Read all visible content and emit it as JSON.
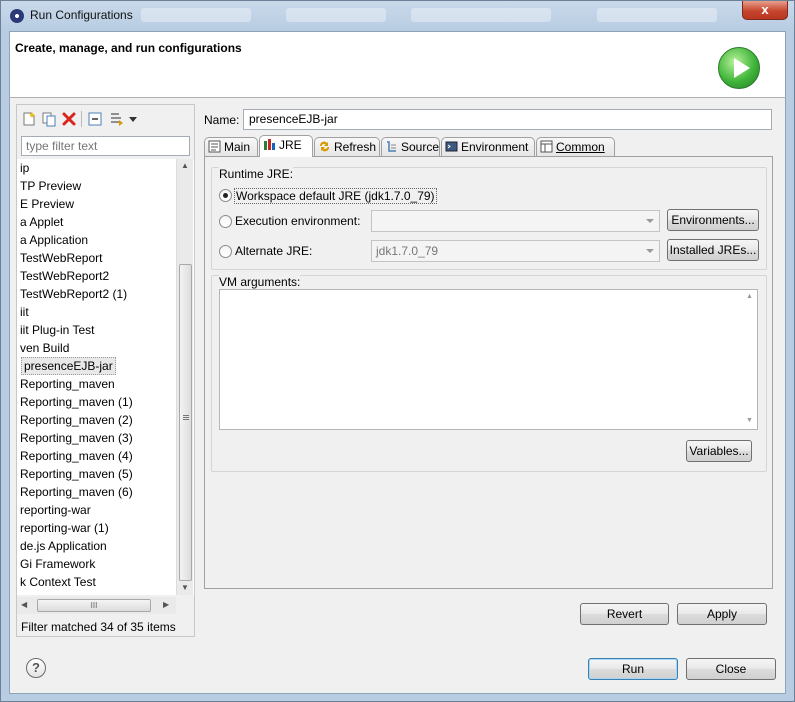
{
  "window": {
    "title": "Run Configurations",
    "close_label": "x"
  },
  "header": {
    "title": "Create, manage, and run configurations"
  },
  "left": {
    "filter_placeholder": "type filter text",
    "items": [
      {
        "label": "ip"
      },
      {
        "label": "TP Preview"
      },
      {
        "label": "E Preview"
      },
      {
        "label": "a Applet"
      },
      {
        "label": "a Application"
      },
      {
        "label": "TestWebReport"
      },
      {
        "label": "TestWebReport2"
      },
      {
        "label": "TestWebReport2 (1)"
      },
      {
        "label": "iit"
      },
      {
        "label": "iit Plug-in Test"
      },
      {
        "label": "ven Build"
      },
      {
        "label": "presenceEJB-jar",
        "selected": true
      },
      {
        "label": "Reporting_maven"
      },
      {
        "label": "Reporting_maven (1)"
      },
      {
        "label": "Reporting_maven (2)"
      },
      {
        "label": "Reporting_maven (3)"
      },
      {
        "label": "Reporting_maven (4)"
      },
      {
        "label": "Reporting_maven (5)"
      },
      {
        "label": "Reporting_maven (6)"
      },
      {
        "label": "reporting-war"
      },
      {
        "label": "reporting-war (1)"
      },
      {
        "label": "de.js Application"
      },
      {
        "label": "Gi Framework"
      },
      {
        "label": "k Context Test"
      }
    ],
    "status": "Filter matched 34 of 35 items",
    "hscroll_grip": "III"
  },
  "config": {
    "name_label": "Name:",
    "name_value": "presenceEJB-jar",
    "tabs": [
      {
        "label": "Main",
        "icon": "main-tab-icon"
      },
      {
        "label": "JRE",
        "icon": "jre-tab-icon",
        "active": true
      },
      {
        "label": "Refresh",
        "icon": "refresh-tab-icon"
      },
      {
        "label": "Source",
        "icon": "source-tab-icon"
      },
      {
        "label": "Environment",
        "icon": "environment-tab-icon"
      },
      {
        "label": "Common",
        "icon": "common-tab-icon"
      }
    ],
    "jre": {
      "group_label": "Runtime JRE:",
      "workspace_default": "Workspace default JRE (jdk1.7.0_79)",
      "execution_env": "Execution environment:",
      "execution_env_value": "",
      "environments_btn": "Environments...",
      "alternate_jre": "Alternate JRE:",
      "alternate_jre_value": "jdk1.7.0_79",
      "installed_jres_btn": "Installed JREs..."
    },
    "vm": {
      "group_label": "VM arguments:",
      "value": "",
      "variables_btn": "Variables..."
    },
    "revert_btn": "Revert",
    "apply_btn": "Apply"
  },
  "footer": {
    "run_btn": "Run",
    "close_btn": "Close"
  },
  "colors": {
    "accent": "#3c7fb1",
    "run_green": "#3fb53a",
    "delete_red": "#d9251d"
  }
}
